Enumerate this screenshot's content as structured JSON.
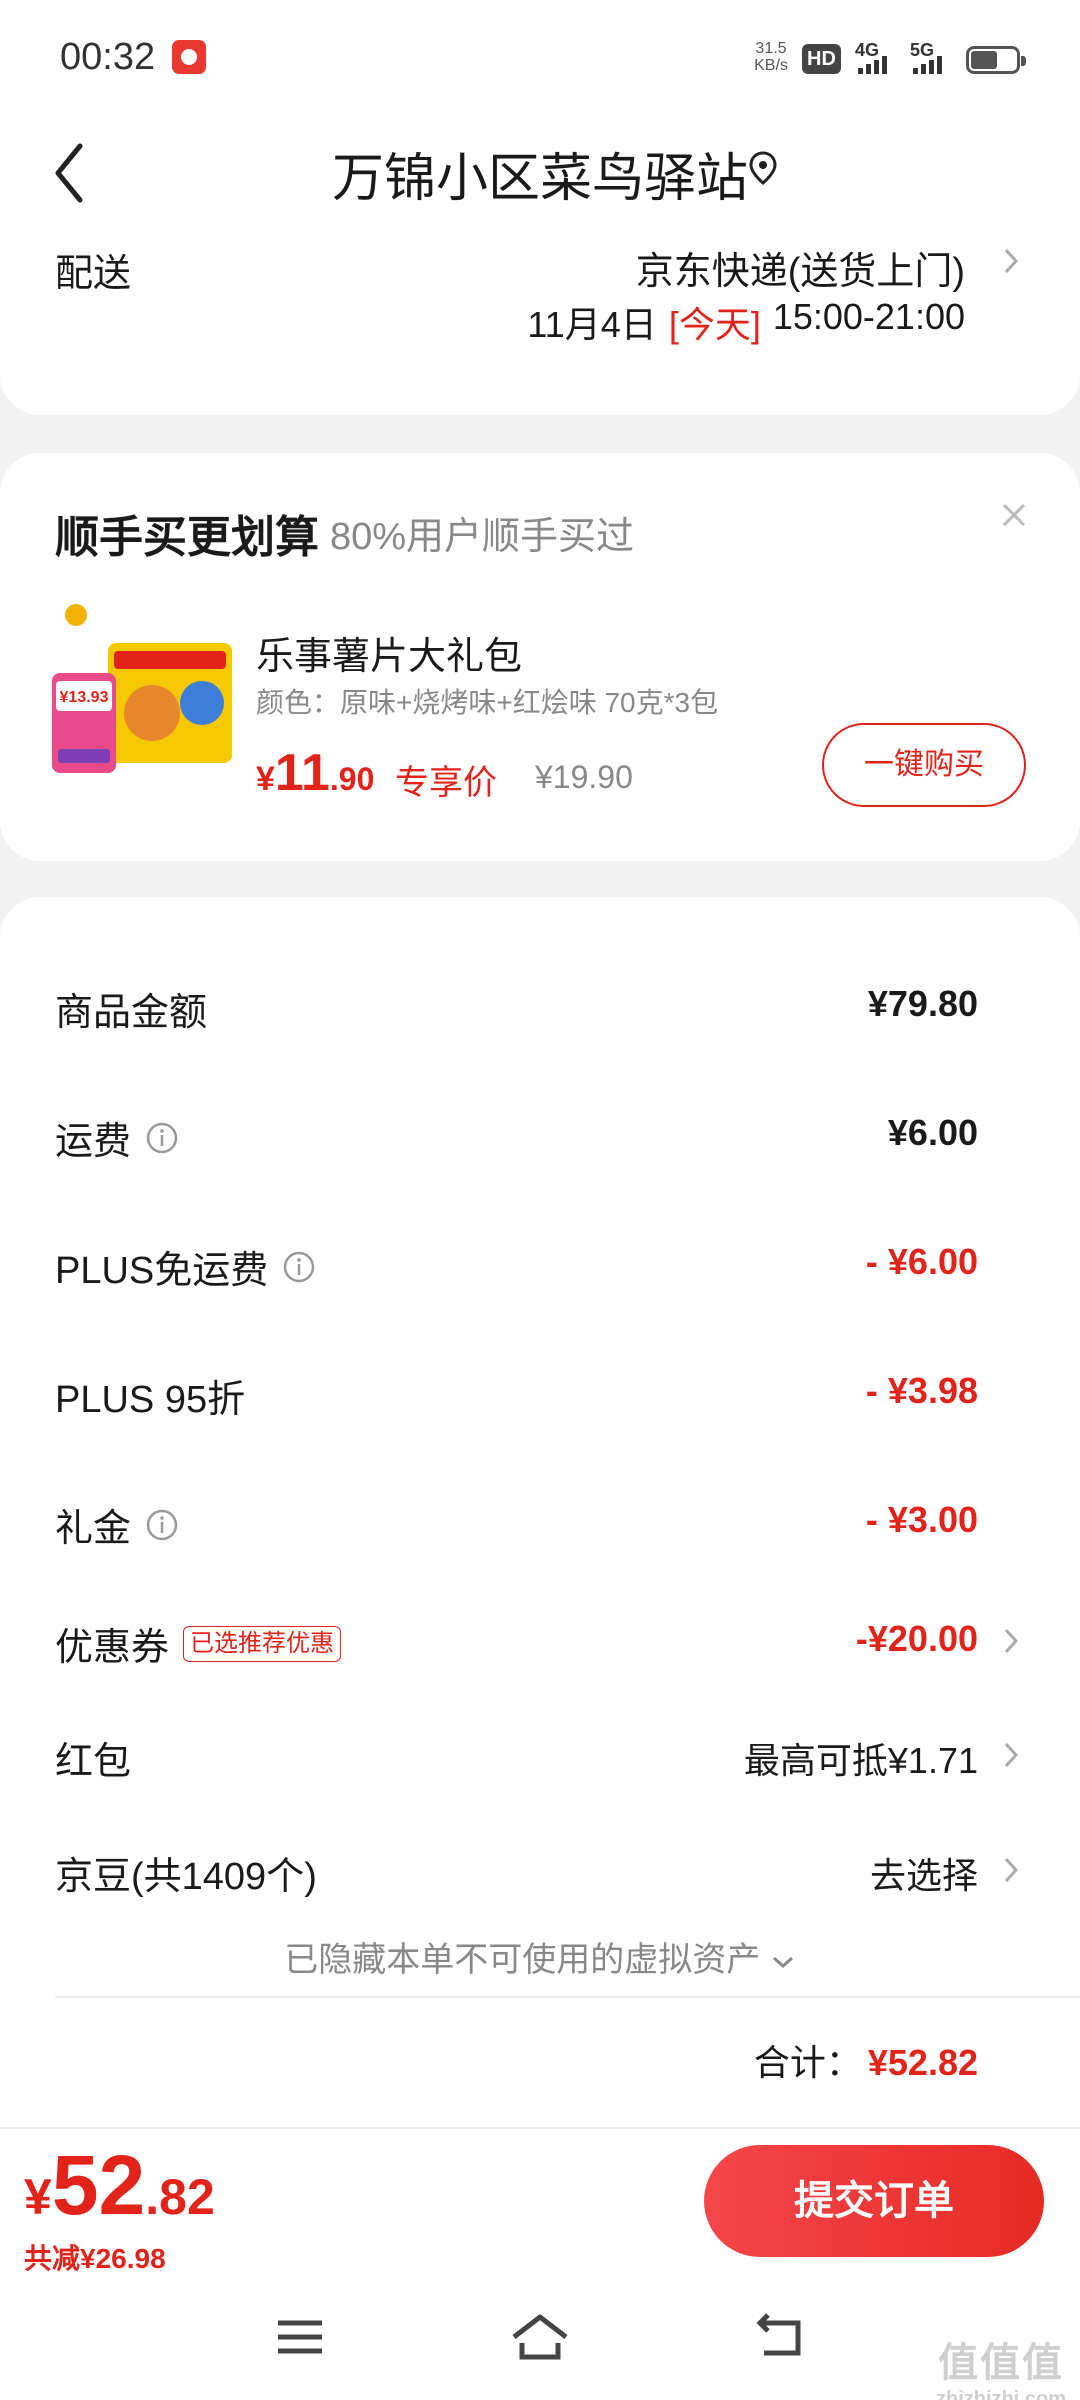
{
  "status_bar": {
    "time": "00:32",
    "net_speed": "31.5",
    "net_unit": "KB/s",
    "hd_label": "HD",
    "sig1_label": "4G",
    "sig2_label": "5G"
  },
  "header": {
    "back_icon": "chevron-left-icon",
    "title": "万锦小区菜鸟驿站",
    "location_icon": "location-pin-icon"
  },
  "delivery": {
    "label": "配送",
    "method": "京东快递(送货上门)",
    "date": "11月4日",
    "today": "[今天]",
    "time_window": "15:00-21:00"
  },
  "upsell": {
    "title": "顺手买更划算",
    "subtitle": "80%用户顺手买过",
    "product": {
      "name": "乐事薯片大礼包",
      "spec": "颜色：原味+烧烤味+红烩味 70克*3包",
      "price_symbol": "¥",
      "price_int": "11",
      "price_dec": ".90",
      "price_tag": "专享价",
      "original_price": "¥19.90",
      "image_price": "¥13.93",
      "buy_label": "一键购买"
    }
  },
  "summary": {
    "rows": [
      {
        "label": "商品金额",
        "value": "¥79.80"
      },
      {
        "label": "运费",
        "value": "¥6.00"
      },
      {
        "label": "PLUS免运费",
        "value": "- ¥6.00"
      },
      {
        "label": "PLUS 95折",
        "value": "- ¥3.98"
      },
      {
        "label": "礼金",
        "value": "- ¥3.00"
      },
      {
        "label": "优惠券",
        "tag": "已选推荐优惠",
        "value": "-¥20.00"
      },
      {
        "label": "红包",
        "value": "最高可抵¥1.71"
      },
      {
        "label": "京豆(共1409个)",
        "value": "去选择"
      }
    ],
    "hidden_assets": "已隐藏本单不可使用的虚拟资产",
    "total_label": "合计：",
    "total_value": "¥52.82"
  },
  "bottom": {
    "price_symbol": "¥",
    "price_int": "52",
    "price_dec": ".82",
    "saved": "共减¥26.98",
    "submit_label": "提交订单"
  },
  "watermark": {
    "main": "值值值",
    "site": "zhizhizhi.com"
  },
  "colors": {
    "accent": "#e2231a",
    "text": "#1a1a1a",
    "muted": "#888888",
    "background": "#f2f2f2"
  }
}
